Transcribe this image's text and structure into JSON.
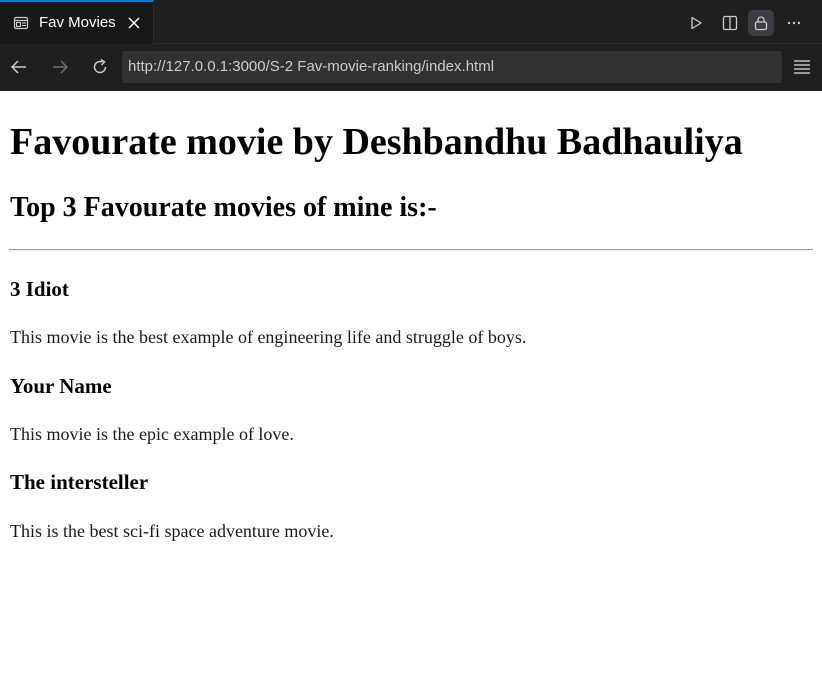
{
  "tab": {
    "title": "Fav Movies"
  },
  "toolbar": {
    "icons": [
      "preview-icon",
      "close-icon",
      "play-icon",
      "split-editor-icon",
      "lock-icon",
      "more-icon"
    ]
  },
  "navigation": {
    "url": "http://127.0.0.1:3000/S-2 Fav-movie-ranking/index.html",
    "icons": [
      "back-arrow-icon",
      "forward-arrow-icon",
      "reload-icon",
      "menu-icon"
    ]
  },
  "page": {
    "heading": "Favourate movie by Deshbandhu Badhauliya",
    "subheading": "Top 3 Favourate movies of mine is:-",
    "movies": [
      {
        "title": "3 Idiot",
        "description": "This movie is the best example of engineering life and struggle of boys."
      },
      {
        "title": "Your Name",
        "description": "This movie is the epic example of love."
      },
      {
        "title": "The intersteller",
        "description": "This is the best sci-fi space adventure movie."
      }
    ]
  }
}
